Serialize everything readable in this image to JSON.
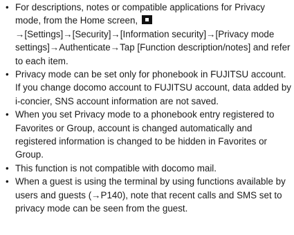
{
  "bullet_glyph": "•",
  "items": [
    {
      "text_a": "For descriptions, notes or compatible applications for Privacy mode, from the Home screen, ",
      "icon": "home-key-icon",
      "text_b": "→[Settings]→[Security]→[Information security]→[Privacy mode settings]→Authenticate→Tap [Function description/notes] and refer to each item."
    },
    {
      "text": "Privacy mode can be set only for phonebook in FUJITSU account. If you change docomo account to FUJITSU account, data added by i-concier, SNS account information are not saved."
    },
    {
      "text": "When you set Privacy mode to a phonebook entry registered to Favorites or Group, account is changed automatically and registered information is changed to be hidden in Favorites or Group."
    },
    {
      "text": "This function is not compatible with docomo mail."
    },
    {
      "text": "When a guest is using the terminal by using functions available by users and guests (→P140), note that recent calls and SMS set to privacy mode can be seen from the guest."
    }
  ]
}
